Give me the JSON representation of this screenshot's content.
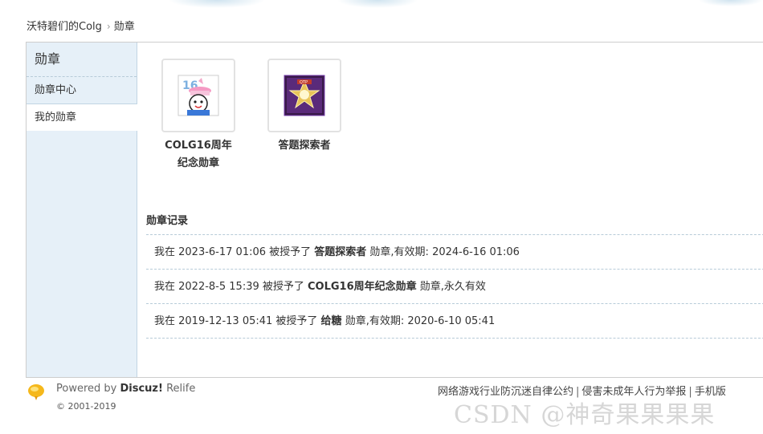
{
  "breadcrumb": {
    "home": "沃特碧们的Colg",
    "separator": "›",
    "current": "勋章"
  },
  "sidebar": {
    "title": "勋章",
    "items": [
      {
        "label": "勋章中心"
      },
      {
        "label": "我的勋章",
        "active": true
      }
    ]
  },
  "medals": [
    {
      "name": "COLG16周年纪念勋章",
      "icon": "colg-16-anniversary-medal-icon"
    },
    {
      "name": "答题探索者",
      "icon": "quiz-explorer-medal-icon"
    }
  ],
  "records": {
    "title": "勋章记录",
    "items": [
      {
        "prefix": "我在 2023-6-17 01:06 被授予了 ",
        "medal": "答题探索者",
        "suffix": " 勋章,有效期: 2024-6-16 01:06"
      },
      {
        "prefix": "我在 2022-8-5 15:39 被授予了 ",
        "medal": "COLG16周年纪念勋章",
        "suffix": " 勋章,永久有效"
      },
      {
        "prefix": "我在 2019-12-13 05:41 被授予了 ",
        "medal": "给糖",
        "suffix": " 勋章,有效期: 2020-6-10 05:41"
      }
    ]
  },
  "footer": {
    "powered_prefix": "Powered by ",
    "powered_brand": "Discuz!",
    "powered_suffix": " Relife",
    "copyright": "© 2001-2019",
    "links": [
      "网络游戏行业防沉迷自律公约",
      "侵害未成年人行为举报",
      "手机版"
    ],
    "separator": "|",
    "watermark": "CSDN @神奇果果果果"
  },
  "colors": {
    "sidebar_bg": "#e6f0f8",
    "border": "#c2d5e3",
    "dashed": "#b7cbd8"
  }
}
